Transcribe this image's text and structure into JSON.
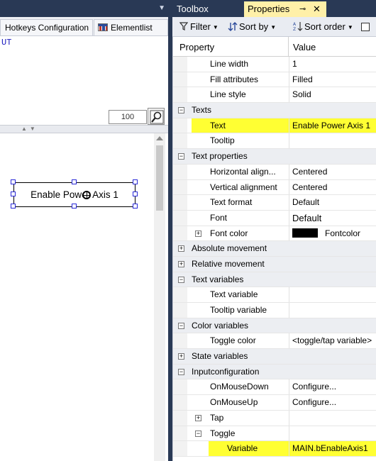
{
  "left": {
    "tabs": [
      {
        "label": "Hotkeys Configuration"
      },
      {
        "label": "Elementlist"
      }
    ],
    "editor_text": "UT",
    "zoom_value": "100",
    "element_label": "Enable Power Axis 1"
  },
  "right": {
    "tabs": {
      "toolbox": "Toolbox",
      "properties": "Properties",
      "pin": "⊸",
      "close": "✕"
    },
    "toolbar": {
      "filter": "Filter",
      "sort_by": "Sort by",
      "sort_order": "Sort order"
    },
    "grid": {
      "col_property": "Property",
      "col_value": "Value",
      "rows": [
        {
          "type": "prop",
          "level": 2,
          "name": "Line width",
          "value": "1"
        },
        {
          "type": "prop",
          "level": 2,
          "name": "Fill attributes",
          "value": "Filled"
        },
        {
          "type": "prop",
          "level": 2,
          "name": "Line style",
          "value": "Solid"
        },
        {
          "type": "cat",
          "level": 1,
          "expander": "−",
          "name": "Texts",
          "value": ""
        },
        {
          "type": "prop",
          "level": 2,
          "name": "Text",
          "value": "Enable Power Axis 1",
          "highlight": true
        },
        {
          "type": "prop",
          "level": 2,
          "name": "Tooltip",
          "value": ""
        },
        {
          "type": "cat",
          "level": 1,
          "expander": "−",
          "name": "Text properties",
          "value": ""
        },
        {
          "type": "prop",
          "level": 2,
          "name": "Horizontal align...",
          "value": "Centered"
        },
        {
          "type": "prop",
          "level": 2,
          "name": "Vertical alignment",
          "value": "Centered"
        },
        {
          "type": "prop",
          "level": 2,
          "name": "Text format",
          "value": "Default"
        },
        {
          "type": "prop",
          "level": 2,
          "name": "Font",
          "value": "Default"
        },
        {
          "type": "prop",
          "level": 2,
          "expander": "+",
          "name": "Font color",
          "value": "Fontcolor",
          "swatch": "#000000"
        },
        {
          "type": "cat",
          "level": 1,
          "expander": "+",
          "name": "Absolute movement",
          "value": ""
        },
        {
          "type": "cat",
          "level": 1,
          "expander": "+",
          "name": "Relative movement",
          "value": ""
        },
        {
          "type": "cat",
          "level": 1,
          "expander": "−",
          "name": "Text variables",
          "value": ""
        },
        {
          "type": "prop",
          "level": 2,
          "name": "Text variable",
          "value": ""
        },
        {
          "type": "prop",
          "level": 2,
          "name": "Tooltip variable",
          "value": ""
        },
        {
          "type": "cat",
          "level": 1,
          "expander": "−",
          "name": "Color variables",
          "value": ""
        },
        {
          "type": "prop",
          "level": 2,
          "name": "Toggle color",
          "value": "<toggle/tap variable>"
        },
        {
          "type": "cat",
          "level": 1,
          "expander": "+",
          "name": "State variables",
          "value": ""
        },
        {
          "type": "cat",
          "level": 1,
          "expander": "−",
          "name": "Inputconfiguration",
          "value": ""
        },
        {
          "type": "prop",
          "level": 2,
          "name": "OnMouseDown",
          "value": "Configure..."
        },
        {
          "type": "prop",
          "level": 2,
          "name": "OnMouseUp",
          "value": "Configure..."
        },
        {
          "type": "sub",
          "level": 2,
          "expander": "+",
          "name": "Tap",
          "value": ""
        },
        {
          "type": "sub",
          "level": 2,
          "expander": "−",
          "name": "Toggle",
          "value": ""
        },
        {
          "type": "prop",
          "level": 3,
          "name": "Variable",
          "value": "MAIN.bEnableAxis1",
          "highlight": true
        }
      ]
    }
  },
  "colors": {
    "highlight": "#ffff33",
    "title_bar": "#293955",
    "active_tab": "#fff0a8",
    "selection_handle": "#2a2ad8"
  }
}
